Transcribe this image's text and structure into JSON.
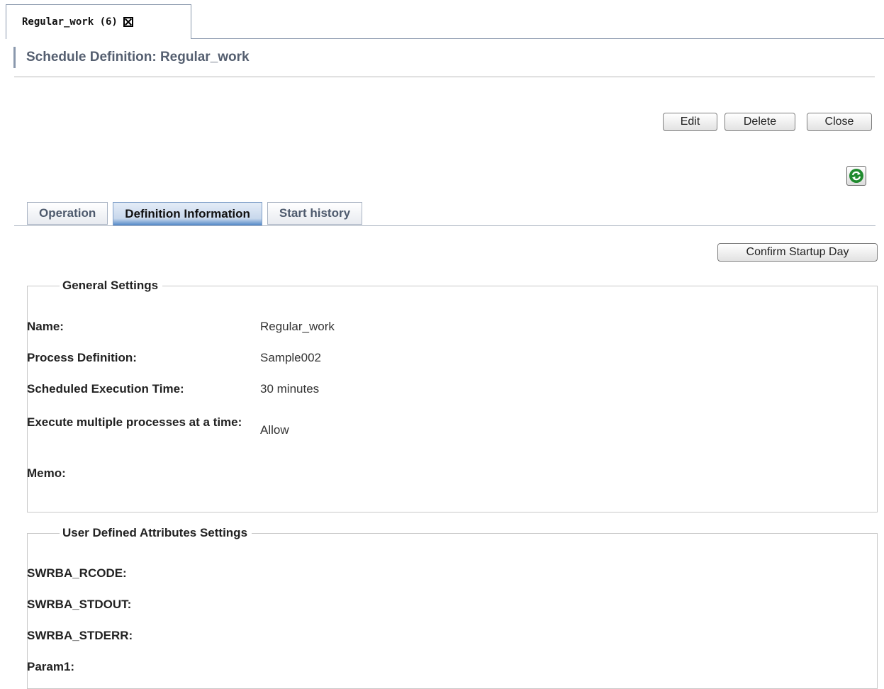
{
  "doc_tab": {
    "label": "Regular_work (6)"
  },
  "page": {
    "title": "Schedule Definition: Regular_work"
  },
  "toolbar": {
    "edit_label": "Edit",
    "delete_label": "Delete",
    "close_label": "Close"
  },
  "tabs": [
    {
      "label": "Operation",
      "active": false
    },
    {
      "label": "Definition Information",
      "active": true
    },
    {
      "label": "Start history",
      "active": false
    }
  ],
  "confirm_button": {
    "label": "Confirm Startup Day"
  },
  "general": {
    "title": "General Settings",
    "rows": [
      {
        "label": "Name:",
        "value": "Regular_work"
      },
      {
        "label": "Process Definition:",
        "value": "Sample002"
      },
      {
        "label": "Scheduled Execution Time:",
        "value": "30 minutes"
      },
      {
        "label": "Execute multiple processes at a time:",
        "value": "Allow"
      },
      {
        "label": "Memo:",
        "value": ""
      }
    ]
  },
  "user_defined": {
    "title": "User Defined Attributes Settings",
    "rows": [
      {
        "label": "SWRBA_RCODE:",
        "value": ""
      },
      {
        "label": "SWRBA_STDOUT:",
        "value": ""
      },
      {
        "label": "SWRBA_STDERR:",
        "value": ""
      },
      {
        "label": "Param1:",
        "value": ""
      }
    ]
  },
  "icons": {
    "refresh": "refresh-icon",
    "close_tab": "close-icon"
  },
  "colors": {
    "accent": "#8a98ad",
    "title_text": "#555f70",
    "active_tab_bottom": "#4f86c6",
    "refresh_green": "#1f8a2e"
  }
}
